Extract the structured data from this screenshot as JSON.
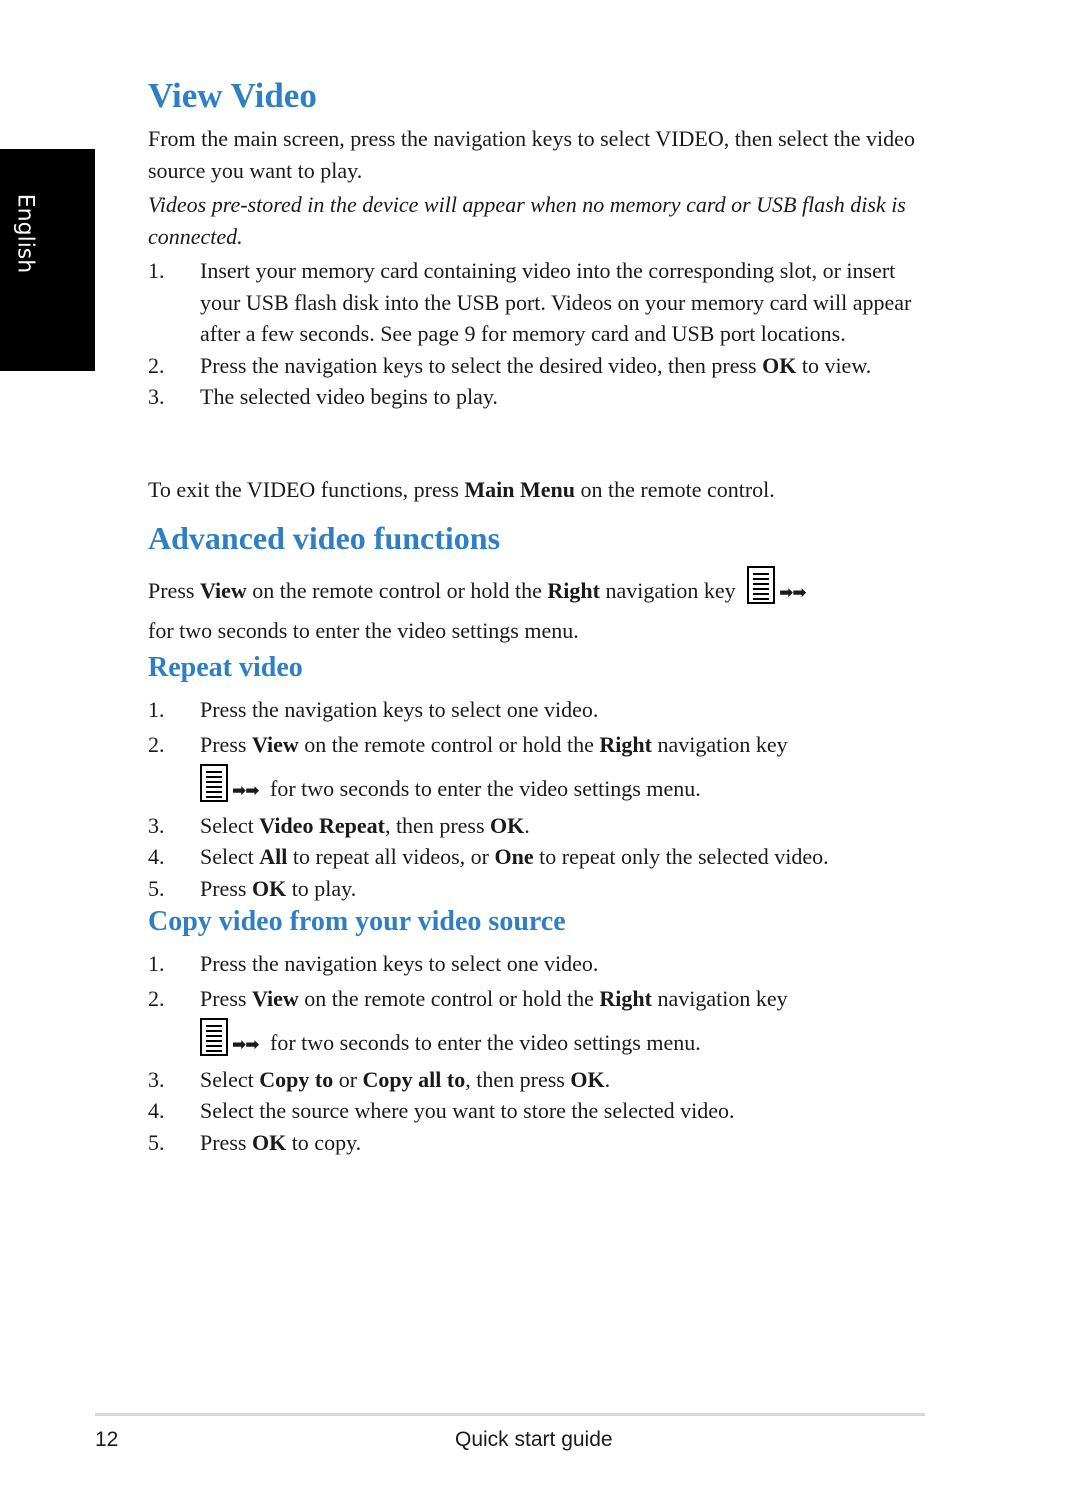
{
  "side_tab": {
    "label": "English"
  },
  "view_video": {
    "title": "View Video",
    "intro": "From the main screen, press the navigation keys to select VIDEO, then select the video source you want to play.",
    "note": "Videos pre-stored in the device will appear when no memory card or USB flash disk is connected.",
    "steps": [
      {
        "num": "1.",
        "text": "Insert your memory card containing video into the corresponding slot, or insert your USB flash disk into the USB port. Videos on your memory card will appear after a few seconds. See page 9 for memory card and USB port locations."
      },
      {
        "num": "2.",
        "pre": "Press the navigation keys to select the desired video, then press ",
        "bold": "OK",
        "post": " to view."
      },
      {
        "num": "3.",
        "text": "The selected video begins to play."
      }
    ],
    "exit": {
      "pre": "To exit the VIDEO functions, press ",
      "bold": "Main Menu",
      "post": " on the remote control."
    }
  },
  "advanced": {
    "title": "Advanced video functions",
    "text": {
      "a": "Press ",
      "b1": "View",
      "c": " on the remote control or hold the ",
      "b2": "Right",
      "d": " navigation key",
      "e": "for two seconds to enter the video settings menu."
    },
    "icon": "menu-key-icon",
    "arrows": "➡➡"
  },
  "repeat": {
    "title": "Repeat video",
    "steps": [
      {
        "num": "1.",
        "text": "Press the navigation keys to select one video."
      },
      {
        "num": "2.",
        "a": "Press ",
        "b1": "View",
        "c": " on the remote control or hold the ",
        "b2": "Right",
        "d": " navigation key",
        "e": " for two seconds to enter the video settings menu."
      },
      {
        "num": "3.",
        "a": "Select ",
        "b1": "Video Repeat",
        "c": ", then press ",
        "b2": "OK",
        "d": "."
      },
      {
        "num": "4.",
        "a": "Select ",
        "b1": "All",
        "c": " to repeat all videos, or ",
        "b2": "One",
        "d": " to repeat only the selected video."
      },
      {
        "num": "5.",
        "a": "Press ",
        "b1": "OK",
        "c": " to play."
      }
    ]
  },
  "copy": {
    "title": "Copy video from your video source",
    "steps": [
      {
        "num": "1.",
        "text": "Press the navigation keys to select one video."
      },
      {
        "num": "2.",
        "a": "Press ",
        "b1": "View",
        "c": " on the remote control or hold the ",
        "b2": "Right",
        "d": " navigation key",
        "e": " for two seconds to enter the video settings menu."
      },
      {
        "num": "3.",
        "a": "Select ",
        "b1": "Copy to",
        "c": " or ",
        "b2": "Copy all to",
        "d": ", then press ",
        "b3": "OK",
        "e": "."
      },
      {
        "num": "4.",
        "text": "Select the source where you want to store the selected video."
      },
      {
        "num": "5.",
        "a": "Press ",
        "b1": "OK",
        "c": " to copy."
      }
    ]
  },
  "footer": {
    "page_number": "12",
    "title": "Quick start guide"
  }
}
